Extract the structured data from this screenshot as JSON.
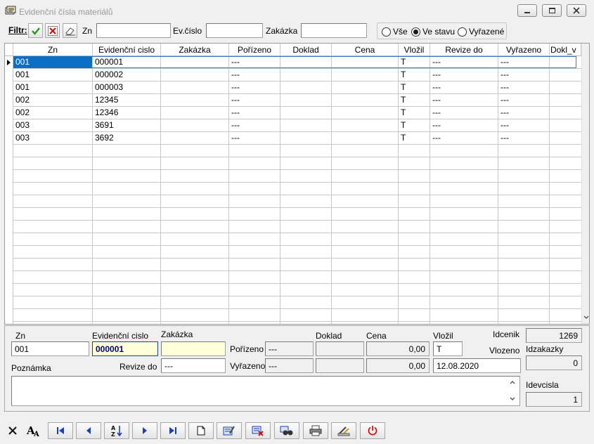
{
  "window": {
    "title": "Evidenční čísla materiálů"
  },
  "filter": {
    "label": "Filtr:",
    "zn_label": "Zn",
    "zn_value": "",
    "evcislo_label": "Ev.číslo",
    "evcislo_value": "",
    "zakazka_label": "Zakázka",
    "zakazka_value": "",
    "radio": {
      "all": "Vše",
      "in_stock": "Ve stavu",
      "discarded": "Vyřazené",
      "selected": "Ve stavu"
    }
  },
  "grid": {
    "columns": [
      "Zn",
      "Evidenční cislo",
      "Zakázka",
      "Pořízeno",
      "Doklad",
      "Cena",
      "Vložil",
      "Revize do",
      "Vyřazeno",
      "Dokl_v"
    ],
    "rows": [
      {
        "zn": "001",
        "ev": "000001",
        "zak": "",
        "por": "---",
        "dok": "",
        "cena": "",
        "vlo": "T",
        "rev": "---",
        "vyr": "---",
        "dokl": ""
      },
      {
        "zn": "001",
        "ev": "000002",
        "zak": "",
        "por": "---",
        "dok": "",
        "cena": "",
        "vlo": "T",
        "rev": "---",
        "vyr": "---",
        "dokl": ""
      },
      {
        "zn": "001",
        "ev": "000003",
        "zak": "",
        "por": "---",
        "dok": "",
        "cena": "",
        "vlo": "T",
        "rev": "---",
        "vyr": "---",
        "dokl": ""
      },
      {
        "zn": "002",
        "ev": "12345",
        "zak": "",
        "por": "---",
        "dok": "",
        "cena": "",
        "vlo": "T",
        "rev": "---",
        "vyr": "---",
        "dokl": ""
      },
      {
        "zn": "002",
        "ev": "12346",
        "zak": "",
        "por": "---",
        "dok": "",
        "cena": "",
        "vlo": "T",
        "rev": "---",
        "vyr": "---",
        "dokl": ""
      },
      {
        "zn": "003",
        "ev": "3691",
        "zak": "",
        "por": "---",
        "dok": "",
        "cena": "",
        "vlo": "T",
        "rev": "---",
        "vyr": "---",
        "dokl": ""
      },
      {
        "zn": "003",
        "ev": "3692",
        "zak": "",
        "por": "---",
        "dok": "",
        "cena": "",
        "vlo": "T",
        "rev": "---",
        "vyr": "---",
        "dokl": ""
      }
    ]
  },
  "detail": {
    "zn_label": "Zn",
    "zn_value": "001",
    "ev_label": "Evidenční cislo",
    "ev_value": "000001",
    "zakazka_label": "Zakázka",
    "zakazka_value": "",
    "doklad_label": "Doklad",
    "cena_label": "Cena",
    "vlozil_label": "Vložil",
    "vlozil_value": "T",
    "idcenik_label": "Idcenik",
    "idcenik_value": "1269",
    "porizeno_label": "Pořízeno",
    "porizeno_value": "---",
    "porizeno_doklad": "",
    "porizeno_cena": "0,00",
    "vlozeno_label": "Vlozeno",
    "idzakazky_label": "Idzakazky",
    "idzakazky_value": "0",
    "revize_label": "Revize do",
    "revize_value": "---",
    "vyrazeno_label": "Vyřazeno",
    "vyrazeno_value": "---",
    "vyrazeno_doklad": "",
    "vyrazeno_cena": "0,00",
    "vlozeno_value": "12.08.2020",
    "poznamka_label": "Poznámka",
    "poznamka_value": "",
    "idevcisla_label": "Idevcisla",
    "idevcisla_value": "1"
  }
}
